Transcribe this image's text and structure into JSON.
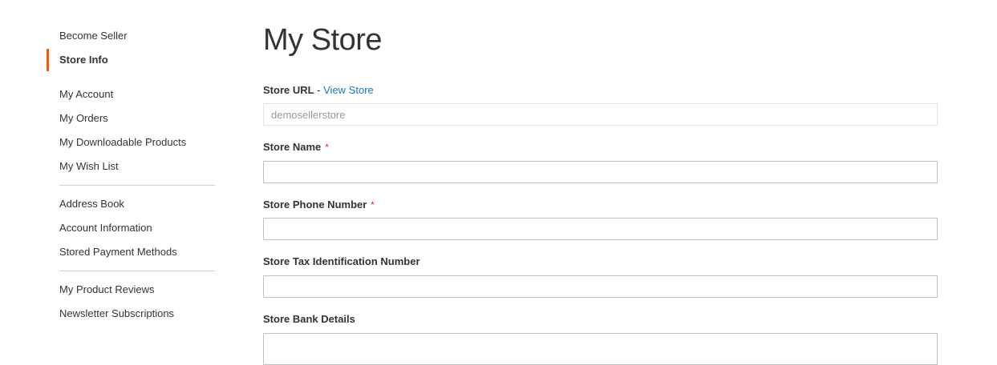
{
  "sidebar": {
    "become_seller": "Become Seller",
    "store_info": "Store Info",
    "my_account": "My Account",
    "my_orders": "My Orders",
    "my_downloadable_products": "My Downloadable Products",
    "my_wish_list": "My Wish List",
    "address_book": "Address Book",
    "account_information": "Account Information",
    "stored_payment_methods": "Stored Payment Methods",
    "my_product_reviews": "My Product Reviews",
    "newsletter_subscriptions": "Newsletter Subscriptions"
  },
  "page": {
    "title": "My Store"
  },
  "form": {
    "store_url_label": "Store URL",
    "store_url_separator": " - ",
    "view_store_link": "View Store",
    "store_url_value": "demosellerstore",
    "store_name_label": "Store Name",
    "store_phone_label": "Store Phone Number",
    "store_tax_label": "Store Tax Identification Number",
    "store_bank_label": "Store Bank Details",
    "required_mark": "*"
  },
  "colors": {
    "accent": "#ff5501",
    "link": "#1979c3",
    "required": "#e02b27"
  }
}
